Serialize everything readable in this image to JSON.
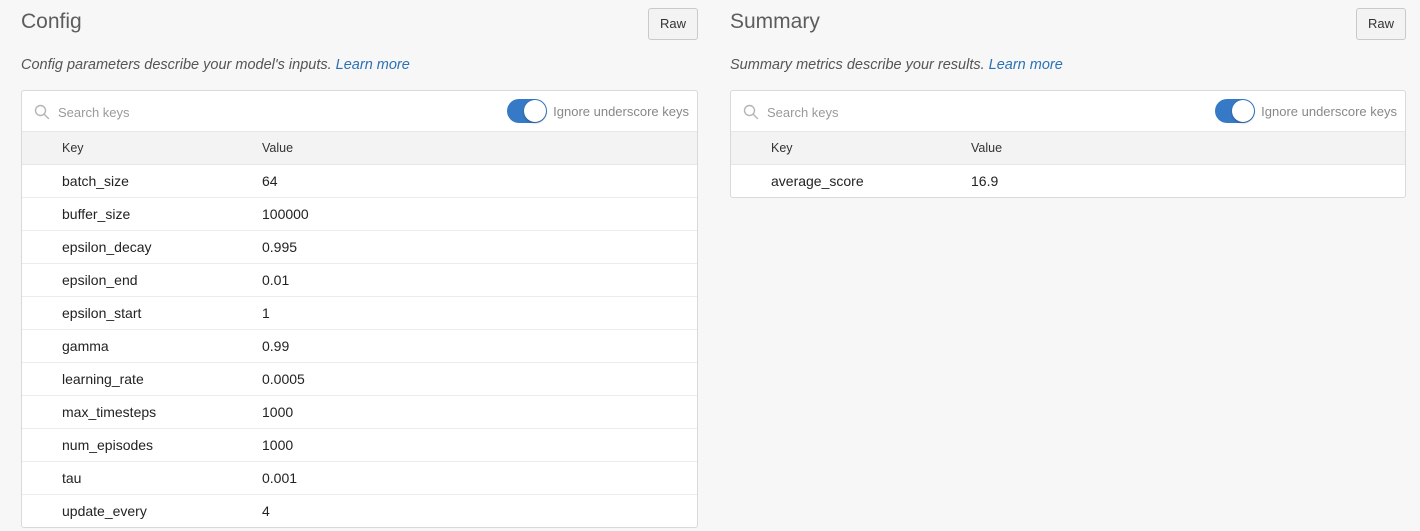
{
  "config": {
    "title": "Config",
    "raw_label": "Raw",
    "description": "Config parameters describe your model's inputs. ",
    "learn_more": "Learn more",
    "search_placeholder": "Search keys",
    "toggle_label": "Ignore underscore keys",
    "toggle_on": true,
    "col_key": "Key",
    "col_value": "Value",
    "rows": [
      {
        "key": "batch_size",
        "value": "64"
      },
      {
        "key": "buffer_size",
        "value": "100000"
      },
      {
        "key": "epsilon_decay",
        "value": "0.995"
      },
      {
        "key": "epsilon_end",
        "value": "0.01"
      },
      {
        "key": "epsilon_start",
        "value": "1"
      },
      {
        "key": "gamma",
        "value": "0.99"
      },
      {
        "key": "learning_rate",
        "value": "0.0005"
      },
      {
        "key": "max_timesteps",
        "value": "1000"
      },
      {
        "key": "num_episodes",
        "value": "1000"
      },
      {
        "key": "tau",
        "value": "0.001"
      },
      {
        "key": "update_every",
        "value": "4"
      }
    ]
  },
  "summary": {
    "title": "Summary",
    "raw_label": "Raw",
    "description": "Summary metrics describe your results. ",
    "learn_more": "Learn more",
    "search_placeholder": "Search keys",
    "toggle_label": "Ignore underscore keys",
    "toggle_on": true,
    "col_key": "Key",
    "col_value": "Value",
    "rows": [
      {
        "key": "average_score",
        "value": "16.9"
      }
    ]
  },
  "colors": {
    "accent": "#3579c7",
    "link": "#2a72b5",
    "background": "#f7f7f7"
  },
  "icons": {
    "search": "search-icon"
  }
}
